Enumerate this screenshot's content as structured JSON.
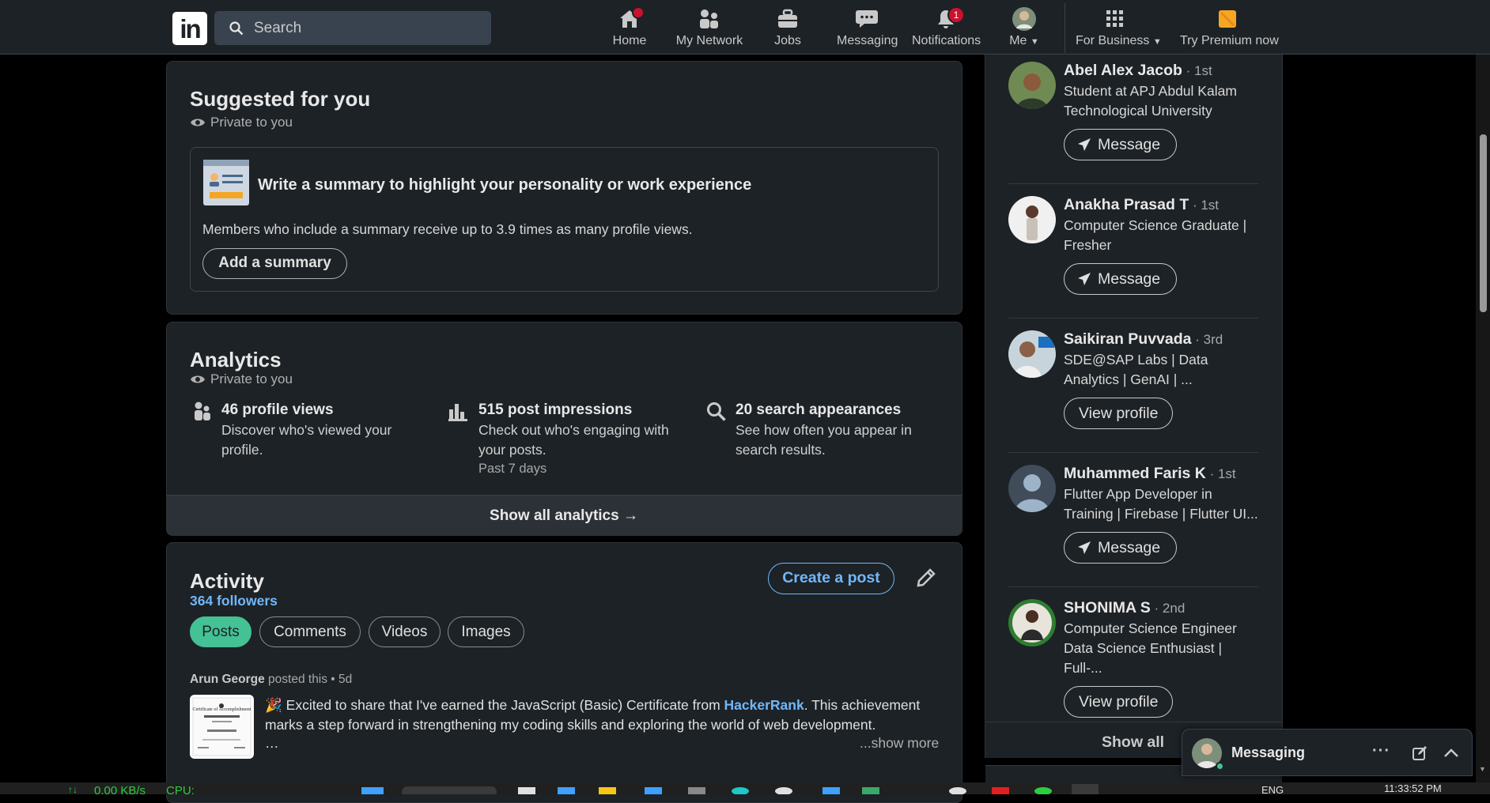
{
  "nav": {
    "logo": "in",
    "search_placeholder": "Search",
    "items": [
      {
        "label": "Home",
        "icon": "home-icon",
        "badge": ""
      },
      {
        "label": "My Network",
        "icon": "people-icon",
        "badge": ""
      },
      {
        "label": "Jobs",
        "icon": "briefcase-icon",
        "badge": ""
      },
      {
        "label": "Messaging",
        "icon": "chat-icon",
        "badge": ""
      },
      {
        "label": "Notifications",
        "icon": "bell-icon",
        "badge": "1"
      },
      {
        "label": "Me",
        "icon": "avatar-icon",
        "badge": ""
      },
      {
        "label": "For Business",
        "icon": "grid-icon",
        "badge": ""
      },
      {
        "label": "Try Premium now",
        "icon": "premium-icon",
        "badge": ""
      }
    ]
  },
  "suggested": {
    "title": "Suggested for you",
    "private": "Private to you",
    "card_title": "Write a summary to highlight your personality or work experience",
    "card_text": "Members who include a summary receive up to 3.9 times as many profile views.",
    "button": "Add a summary"
  },
  "analytics": {
    "title": "Analytics",
    "private": "Private to you",
    "stats": [
      {
        "title": "46 profile views",
        "desc": "Discover who's viewed your profile.",
        "meta": ""
      },
      {
        "title": "515 post impressions",
        "desc": "Check out who's engaging with your posts.",
        "meta": "Past 7 days"
      },
      {
        "title": "20 search appearances",
        "desc": "See how often you appear in search results.",
        "meta": ""
      }
    ],
    "show_all": "Show all analytics →"
  },
  "activity": {
    "title": "Activity",
    "followers": "364 followers",
    "create_post": "Create a post",
    "tabs": [
      "Posts",
      "Comments",
      "Videos",
      "Images"
    ],
    "post": {
      "author": "Arun George",
      "action": " posted this • 5d",
      "emoji": "🎉",
      "text_before": " Excited to share that I've earned the JavaScript (Basic) Certificate from ",
      "link": "HackerRank",
      "text_after": ". This achievement marks a step forward in strengthening my coding skills and exploring the world of web development.",
      "ellipsis": "…",
      "show_more": "...show more",
      "thumb_title": "Certificate of Accomplishment"
    }
  },
  "people": [
    {
      "name": "Abel Alex Jacob",
      "degree": " · 1st",
      "headline": "Student at APJ Abdul Kalam Technological University",
      "action": "Message"
    },
    {
      "name": "Anakha Prasad T",
      "degree": " · 1st",
      "headline": "Computer Science Graduate | Fresher",
      "action": "Message"
    },
    {
      "name": "Saikiran Puvvada",
      "degree": " · 3rd",
      "headline": "SDE@SAP Labs | Data Analytics | GenAI | ...",
      "action": "View profile"
    },
    {
      "name": "Muhammed Faris K",
      "degree": " · 1st",
      "headline": "Flutter App Developer in Training | Firebase | Flutter UI...",
      "action": "Message"
    },
    {
      "name": "SHONIMA S",
      "degree": " · 2nd",
      "headline": "Computer Science Engineer Data Science Enthusiast | Full-...",
      "action": "View profile"
    }
  ],
  "people_show_all": "Show all",
  "messaging": {
    "title": "Messaging"
  },
  "taskbar": {
    "net": "0.00 KB/s",
    "cpu": "CPU:",
    "lang": "ENG",
    "time": "11:33:52 PM"
  },
  "colors": {
    "accent": "#71b7fb",
    "active_tab": "#44c195",
    "badge": "#cb112d",
    "premium": "#f5a623"
  }
}
